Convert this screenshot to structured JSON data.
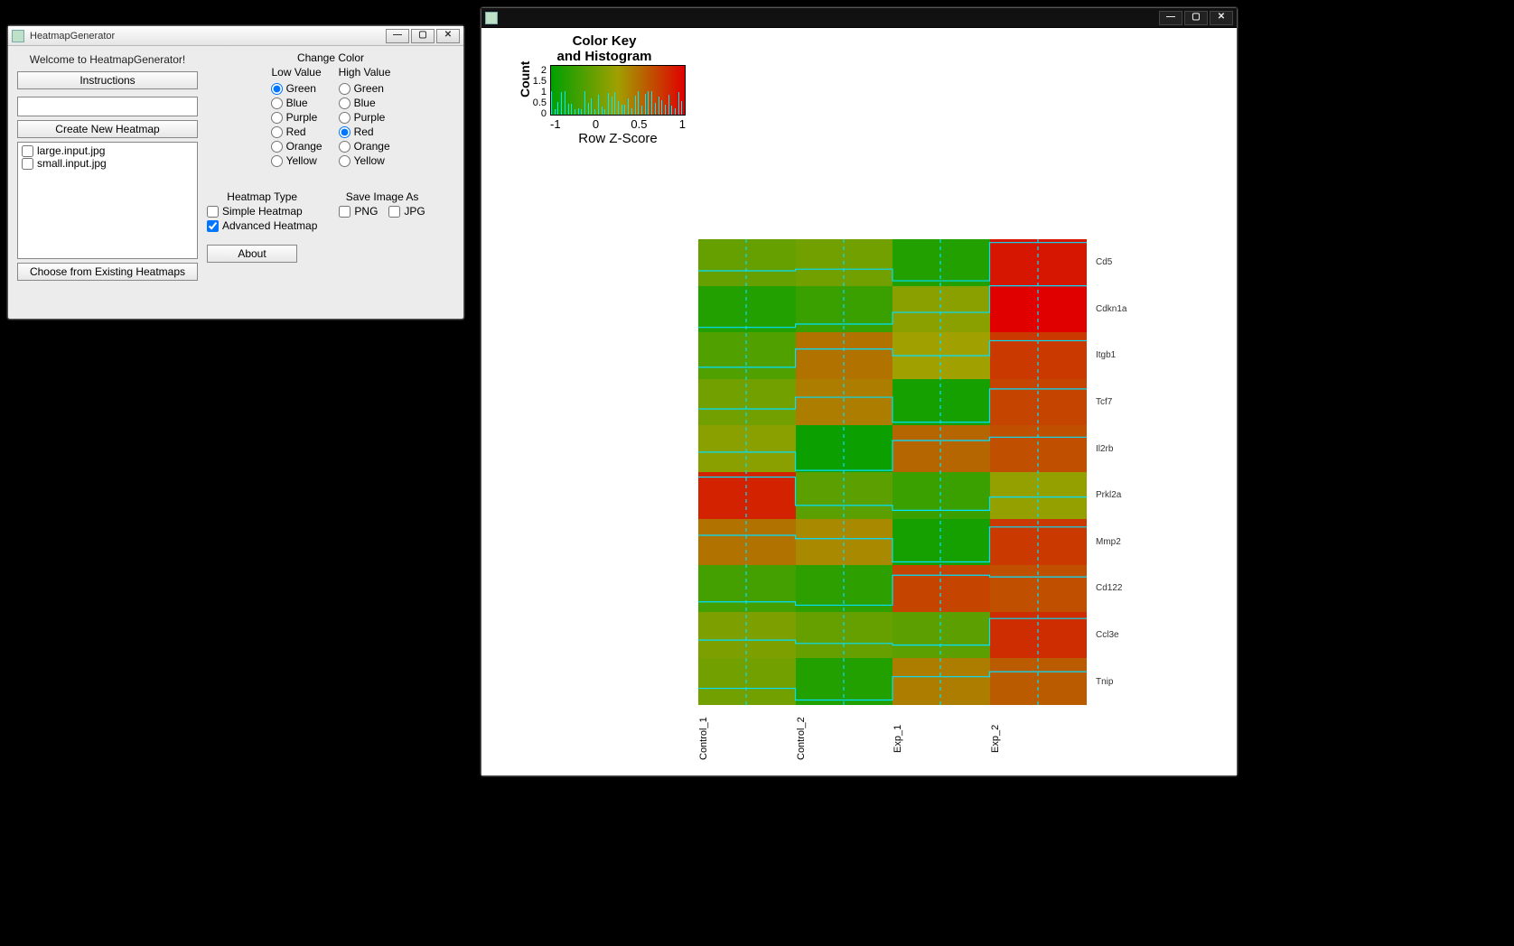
{
  "generator_window": {
    "title": "HeatmapGenerator",
    "welcome": "Welcome to HeatmapGenerator!",
    "instructions_btn": "Instructions",
    "create_btn": "Create New Heatmap",
    "existing_btn": "Choose from Existing Heatmaps",
    "files": [
      "large.input.jpg",
      "small.input.jpg"
    ],
    "change_color_title": "Change Color",
    "low_value_label": "Low Value",
    "high_value_label": "High Value",
    "color_options": [
      "Green",
      "Blue",
      "Purple",
      "Red",
      "Orange",
      "Yellow"
    ],
    "low_selected": "Green",
    "high_selected": "Red",
    "heatmap_type_label": "Heatmap Type",
    "heatmap_types": {
      "simple": {
        "label": "Simple Heatmap",
        "checked": false
      },
      "advanced": {
        "label": "Advanced Heatmap",
        "checked": true
      }
    },
    "save_as_label": "Save Image As",
    "save_formats": {
      "png": {
        "label": "PNG",
        "checked": false
      },
      "jpg": {
        "label": "JPG",
        "checked": false
      }
    },
    "about_btn": "About"
  },
  "plot_window": {
    "title": ""
  },
  "chart_data": [
    {
      "type": "heatmap",
      "title": "",
      "xlabel": "",
      "ylabel": "",
      "col_labels": [
        "Control_1",
        "Control_2",
        "Exp_1",
        "Exp_2"
      ],
      "row_labels": [
        "Cd5",
        "Cdkn1a",
        "Itgb1",
        "Tcf7",
        "Il2rb",
        "Prkl2a",
        "Mmp2",
        "Cd122",
        "Ccl3e",
        "Tnip"
      ],
      "z": [
        [
          -0.5,
          -0.4,
          -1.1,
          1.2
        ],
        [
          -1.1,
          -0.9,
          -0.2,
          1.4
        ],
        [
          -0.7,
          0.4,
          0.0,
          0.9
        ],
        [
          -0.4,
          0.3,
          -1.2,
          0.8
        ],
        [
          -0.2,
          -1.3,
          0.5,
          0.7
        ],
        [
          1.1,
          -0.6,
          -0.9,
          -0.1
        ],
        [
          0.4,
          0.2,
          -1.2,
          0.9
        ],
        [
          -0.8,
          -1.0,
          0.8,
          0.7
        ],
        [
          -0.3,
          -0.5,
          -0.6,
          1.0
        ],
        [
          -0.4,
          -1.1,
          0.3,
          0.6
        ]
      ],
      "zmin": -1.4,
      "zmax": 1.4,
      "colormap_low": "#00a000",
      "colormap_mid": "#a0a000",
      "colormap_high": "#e00000"
    },
    {
      "type": "bar",
      "title": "Color Key\nand Histogram",
      "xlabel": "Row Z-Score",
      "ylabel": "Count",
      "xlim": [
        -1.4,
        1.4
      ],
      "ylim": [
        0,
        2
      ],
      "xticks": [
        -1,
        0,
        0.5,
        1
      ],
      "yticks": [
        0,
        0.5,
        1,
        1.5,
        2
      ],
      "bins": 40
    }
  ]
}
